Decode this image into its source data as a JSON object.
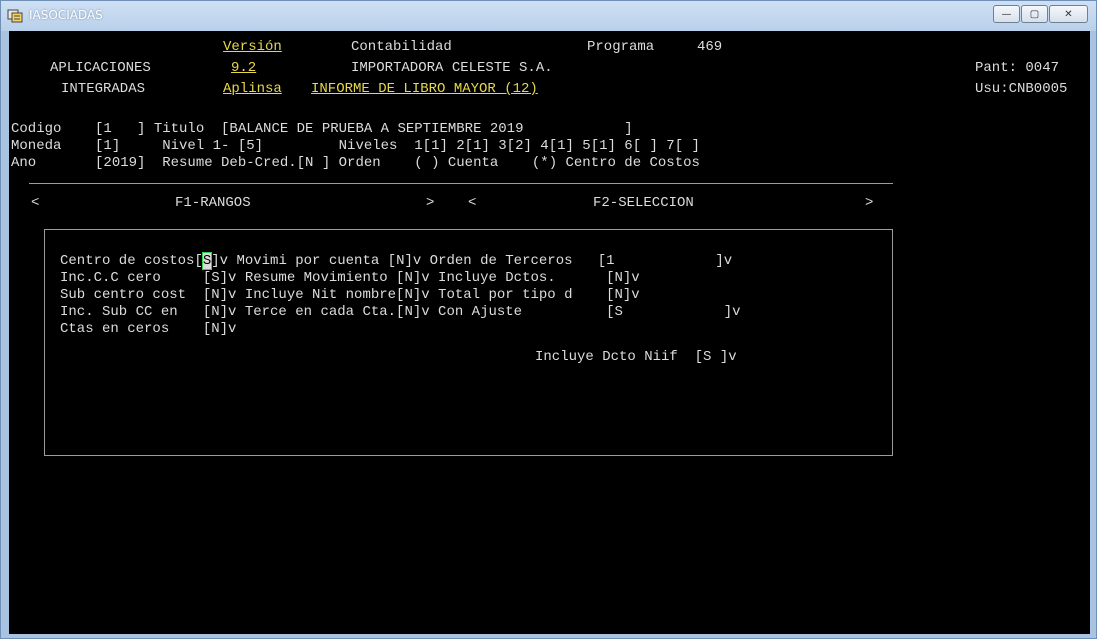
{
  "window": {
    "title": "IASOCIADAS",
    "minimize_glyph": "—",
    "maximize_glyph": "▢",
    "close_glyph": "✕"
  },
  "header": {
    "aplicaciones": "APLICACIONES",
    "integradas": "INTEGRADAS",
    "version_label": "Versión",
    "version_value": "9.2",
    "aplinsa": "Aplinsa",
    "contabilidad": "Contabilidad",
    "programa": "Programa",
    "programa_num": "469",
    "company": "IMPORTADORA CELESTE S.A.",
    "report_title": "INFORME DE LIBRO MAYOR (12)",
    "pant": "Pant: 0047",
    "usu": "Usu:CNB0005"
  },
  "fields": {
    "codigo": "Codigo    [1   ] Titulo  [BALANCE DE PRUEBA A SEPTIEMBRE 2019            ]",
    "moneda": "Moneda    [1]     Nivel 1- [5]         Niveles  1[1] 2[1] 3[2] 4[1] 5[1] 6[ ] 7[ ]",
    "ano": "Ano       [2019]  Resume Deb-Cred.[N ] Orden    ( ) Cuenta    (*) Centro de Costos"
  },
  "tabs": {
    "left_arrow": "<",
    "f1": "F1-RANGOS",
    "mid_arrows": ">    <",
    "f2": "F2-SELECCION",
    "right_arrow": ">"
  },
  "panel": {
    "row1": {
      "pre": "Centro de costos[",
      "cursor": "S",
      "post": "]v Movimi por cuenta [N]v Orden de Terceros   [1            ]v"
    },
    "row2": "Inc.C.C cero     [S]v Resume Movimiento [N]v Incluye Dctos.      [N]v",
    "row3": "Sub centro cost  [N]v Incluye Nit nombre[N]v Total por tipo d    [N]v",
    "row4": "Inc. Sub CC en   [N]v Terce en cada Cta.[N]v Con Ajuste          [S            ]v",
    "row5": "Ctas en ceros    [N]v",
    "row6": "Incluye Dcto Niif  [S ]v"
  }
}
